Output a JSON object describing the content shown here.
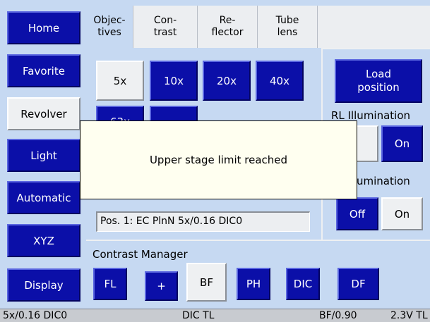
{
  "nav": {
    "home": "Home",
    "favorite": "Favorite",
    "revolver": "Revolver",
    "light": "Light",
    "automatic": "Automatic",
    "xyz": "XYZ",
    "display": "Display"
  },
  "tabs": {
    "objectives": "Objec-\ntives",
    "contrast": "Con-\ntrast",
    "reflector": "Re-\nflector",
    "tube_lens": "Tube\nlens"
  },
  "objectives": {
    "mag_5x": "5x",
    "mag_10x": "10x",
    "mag_20x": "20x",
    "mag_40x": "40x",
    "mag_63x": "63x",
    "position_info": "Pos. 1: EC PlnN 5x/0.16 DIC0"
  },
  "right_panel": {
    "load_position": "Load\nposition",
    "rl_illumination_label": "RL Illumination",
    "rl_on": "On",
    "tl_illumination_label": "umination",
    "tl_off": "Off",
    "tl_on": "On"
  },
  "contrast_manager": {
    "label": "Contrast Manager",
    "fl": "FL",
    "plus": "+",
    "bf": "BF",
    "ph": "PH",
    "dic": "DIC",
    "df": "DF"
  },
  "dialog": {
    "message": "Upper stage limit reached"
  },
  "status": {
    "objective": "5x/0.16 DIC0",
    "contrast": "DIC TL",
    "bf": "BF/0.90",
    "voltage": "2.3V TL"
  },
  "colors": {
    "button_blue": "#0b0fa8",
    "panel_bg": "#c6d9f2",
    "dialog_bg": "#fffff0"
  }
}
